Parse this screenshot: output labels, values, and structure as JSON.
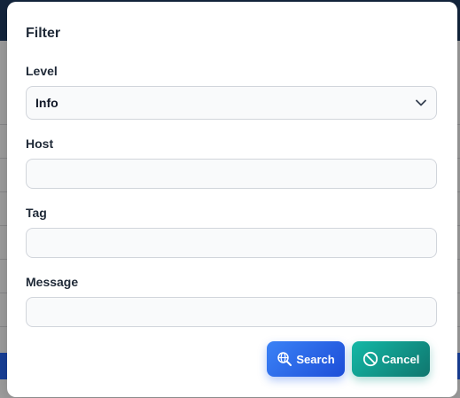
{
  "dialog": {
    "title": "Filter"
  },
  "fields": {
    "level": {
      "label": "Level",
      "selected": "Info"
    },
    "host": {
      "label": "Host",
      "value": "",
      "placeholder": ""
    },
    "tag": {
      "label": "Tag",
      "value": "",
      "placeholder": ""
    },
    "message": {
      "label": "Message",
      "value": "",
      "placeholder": ""
    }
  },
  "actions": {
    "search_label": "Search",
    "search_icon": "globe-search-icon",
    "cancel_label": "Cancel",
    "cancel_icon": "ban-icon"
  },
  "colors": {
    "search_button": "#2563eb",
    "cancel_button": "#0d9488",
    "input_border": "#d1d5db",
    "input_background": "#f9fafb"
  }
}
